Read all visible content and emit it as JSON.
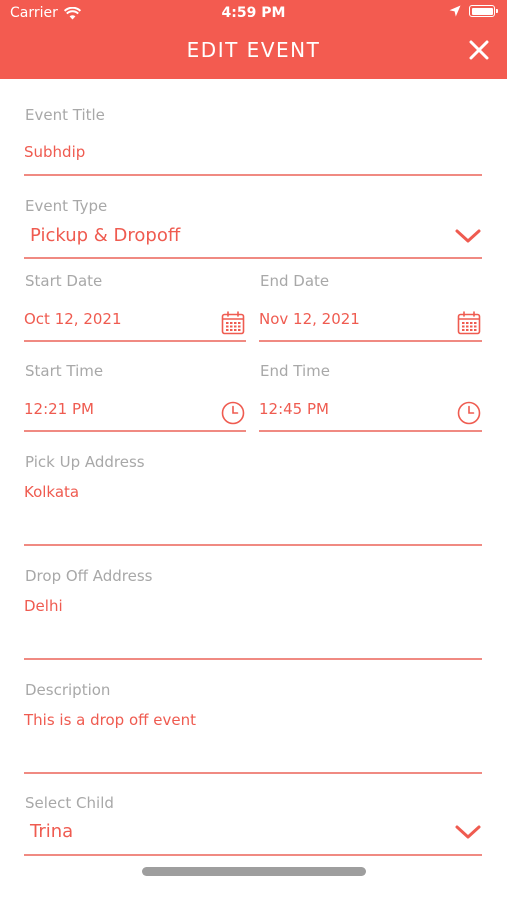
{
  "status_bar": {
    "carrier": "Carrier",
    "time": "4:59 PM"
  },
  "header": {
    "title": "EDIT EVENT"
  },
  "form": {
    "event_title": {
      "label": "Event Title",
      "value": "Subhdip"
    },
    "event_type": {
      "label": "Event Type",
      "value": "Pickup & Dropoff"
    },
    "start_date": {
      "label": "Start Date",
      "value": "Oct 12, 2021"
    },
    "end_date": {
      "label": "End Date",
      "value": "Nov 12, 2021"
    },
    "start_time": {
      "label": "Start Time",
      "value": "12:21 PM"
    },
    "end_time": {
      "label": "End Time",
      "value": "12:45 PM"
    },
    "pickup_address": {
      "label": "Pick Up Address",
      "value": "Kolkata"
    },
    "dropoff_address": {
      "label": "Drop Off Address",
      "value": "Delhi"
    },
    "description": {
      "label": "Description",
      "value": "This is a drop off event"
    },
    "select_child": {
      "label": "Select Child",
      "value": "Trina"
    }
  },
  "colors": {
    "accent": "#f35b50",
    "label": "#a8a8a8",
    "value": "#ef5b50"
  }
}
